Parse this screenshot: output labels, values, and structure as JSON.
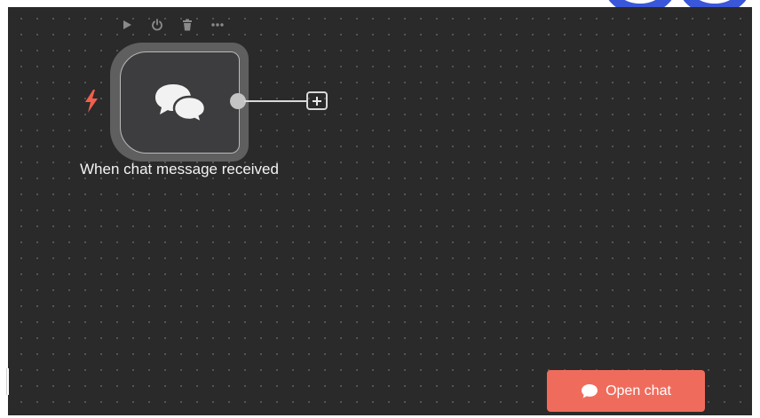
{
  "canvas": {
    "background_color": "#2a2a2a",
    "grid": true
  },
  "node_toolbar": {
    "items": [
      {
        "icon": "play-icon"
      },
      {
        "icon": "power-icon"
      },
      {
        "icon": "trash-icon"
      },
      {
        "icon": "more-icon"
      }
    ]
  },
  "trigger_node": {
    "icon": "chat-bubbles-icon",
    "trigger_marker_icon": "lightning-bolt-icon",
    "trigger_marker_color": "#f0604d",
    "label": "When chat message received"
  },
  "connector": {
    "add_icon": "plus-icon"
  },
  "open_chat_button": {
    "label": "Open chat",
    "icon": "chat-bubble-icon",
    "color": "#ef6c5d"
  }
}
